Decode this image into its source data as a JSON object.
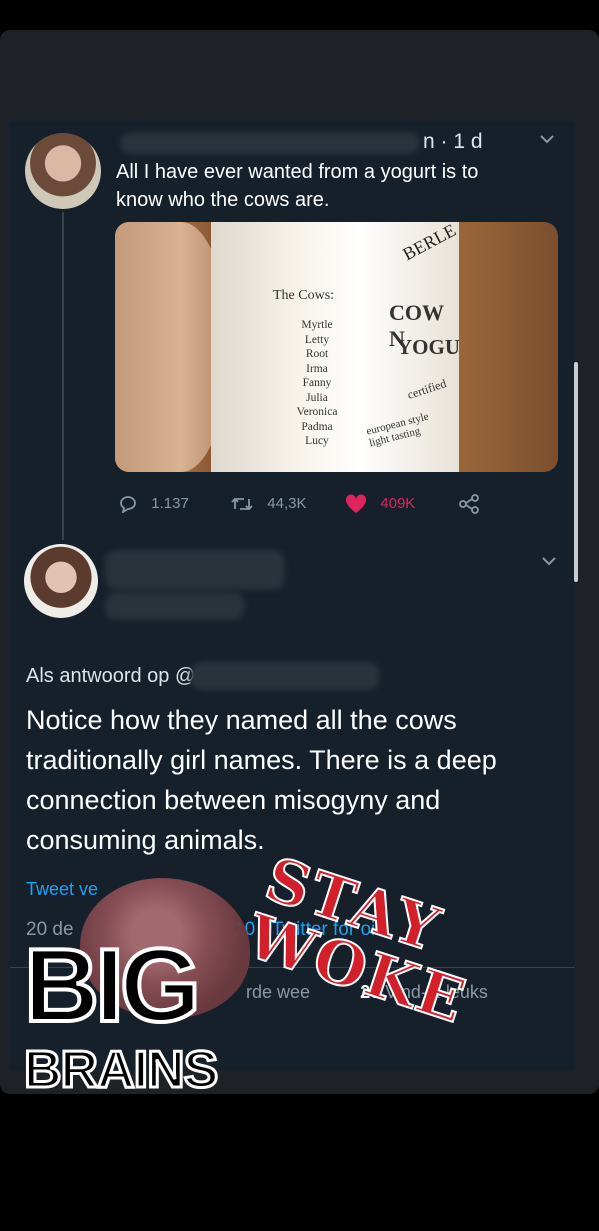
{
  "tweet1": {
    "meta": "n · 1 d",
    "text": "All I have ever wanted from a yogurt is to know who the cows are.",
    "media": {
      "label_title": "The Cows:",
      "cow_names": [
        "Myrtle",
        "Letty",
        "Root",
        "Irma",
        "Fanny",
        "Julia",
        "Veronica",
        "Padma",
        "Lucy"
      ],
      "brand": "BERLE",
      "product_line1": "COW N",
      "product_line2": "YOGU",
      "certified": "certified",
      "style": "european style",
      "tasting": "light tasting"
    },
    "actions": {
      "replies": "1.137",
      "retweets": "44,3K",
      "likes": "409K"
    }
  },
  "tweet2": {
    "reply_to": "Als antwoord op @",
    "text": "Notice how they named all the cows traditionally girl names. There is a deep connection between misogyny and consuming animals.",
    "via": "Tweet ve",
    "date": "20 de",
    "client": "10 · Twitter for    oid",
    "stats_retweets_label": "rde      wee",
    "stats_likes_count": "26",
    "stats_likes_label": "Vind-ik-leuks"
  },
  "overlay": {
    "big": "BIG",
    "brains": "BRAINS",
    "stay_woke": "STAY WOKE"
  },
  "colors": {
    "background": "#15202b",
    "accent": "#1da1f2",
    "like": "#e0245e",
    "woke": "#d21f2a"
  }
}
